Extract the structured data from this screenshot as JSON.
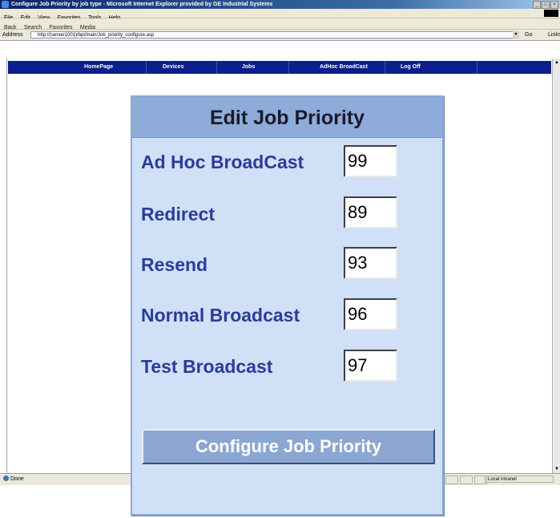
{
  "browser": {
    "window_title": "Configure Job Priority by job type - Microsoft Internet Explorer provided by GE Industrial Systems",
    "window_buttons": [
      "_",
      "□",
      "×"
    ],
    "menu": [
      "File",
      "Edit",
      "View",
      "Favorites",
      "Tools",
      "Help"
    ],
    "toolbar": [
      "Back",
      "Search",
      "Favorites",
      "Media"
    ],
    "address_label": "Address",
    "address_url": "http://(server1001)/bpi/main/Job_priority_configure.asp",
    "go_label": "Go",
    "links_label": "Links",
    "status_text": "Done",
    "zone_text": "Local intranet"
  },
  "navbar": {
    "items": [
      "HomePage",
      "Devices",
      "Jobs",
      "AdHoc BroadCast",
      "Log Off"
    ]
  },
  "dialog": {
    "title": "Edit Job Priority",
    "rows": [
      {
        "label": "Ad Hoc BroadCast",
        "value": "99"
      },
      {
        "label": "Redirect",
        "value": "89"
      },
      {
        "label": "Resend",
        "value": "93"
      },
      {
        "label": "Normal Broadcast",
        "value": "96"
      },
      {
        "label": "Test Broadcast",
        "value": "97"
      }
    ],
    "button_label": "Configure Job Priority"
  },
  "colors": {
    "navbar_bg": "#0a1e8c",
    "dialog_bg": "#cfe0f7",
    "dialog_header_bg": "#8eabd9",
    "label_color": "#2c3c9a",
    "button_bg": "#8ca6d2"
  }
}
